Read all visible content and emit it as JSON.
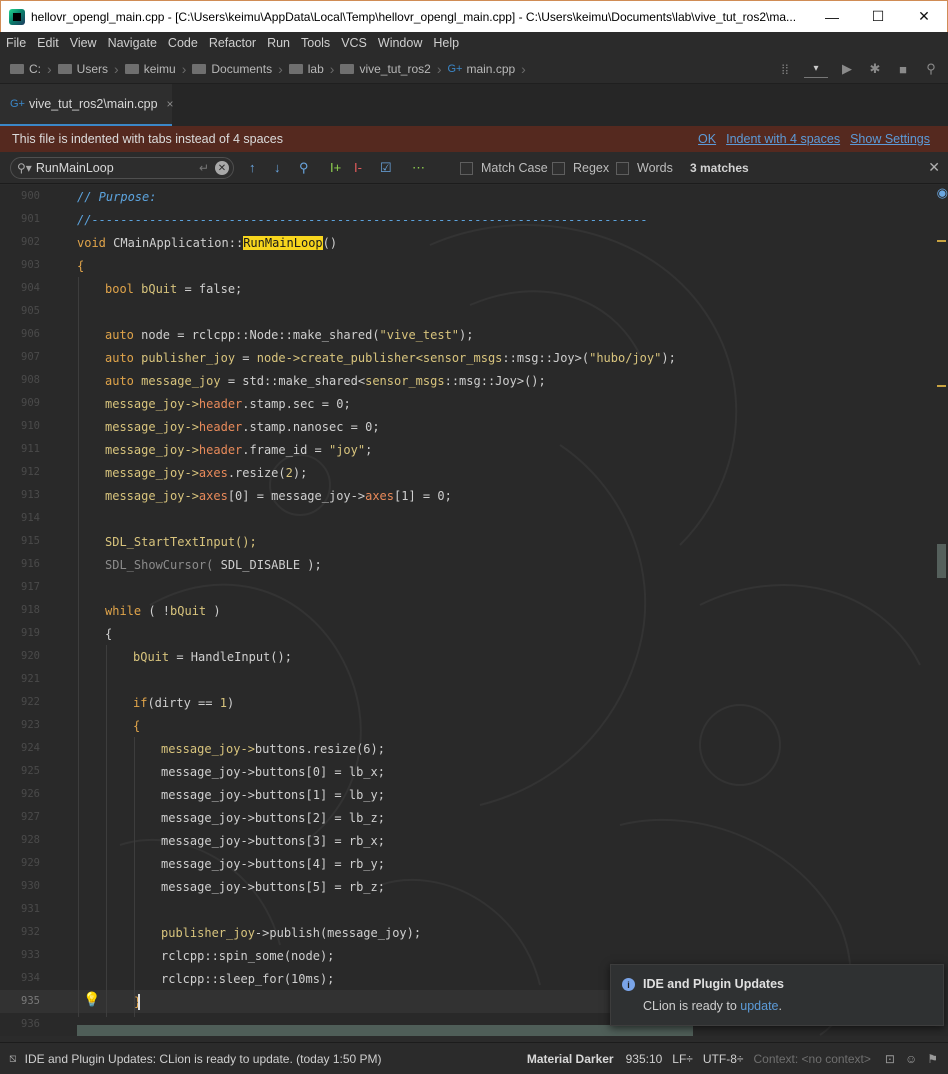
{
  "window": {
    "title": "hellovr_opengl_main.cpp - [C:\\Users\\keimu\\AppData\\Local\\Temp\\hellovr_opengl_main.cpp] - C:\\Users\\keimu\\Documents\\lab\\vive_tut_ros2\\ma...",
    "minimize": "—",
    "maximize": "☐",
    "close": "✕"
  },
  "menu": [
    "File",
    "Edit",
    "View",
    "Navigate",
    "Code",
    "Refactor",
    "Run",
    "Tools",
    "VCS",
    "Window",
    "Help"
  ],
  "breadcrumbs": [
    "C:",
    "Users",
    "keimu",
    "Documents",
    "lab",
    "vive_tut_ros2",
    "main.cpp"
  ],
  "tab": {
    "label": "vive_tut_ros2\\main.cpp",
    "close": "×",
    "icon": "cpp-file-icon"
  },
  "banner": {
    "message": "This file is indented with tabs instead of 4 spaces",
    "ok": "OK",
    "indent": "Indent with 4 spaces",
    "settings": "Show Settings"
  },
  "search": {
    "value": "RunMainLoop",
    "match_case": "Match Case",
    "regex": "Regex",
    "words": "Words",
    "matches": "3 matches"
  },
  "line_numbers": [
    "900",
    "901",
    "902",
    "903",
    "904",
    "905",
    "906",
    "907",
    "908",
    "909",
    "910",
    "911",
    "912",
    "913",
    "914",
    "915",
    "916",
    "917",
    "918",
    "919",
    "920",
    "921",
    "922",
    "923",
    "924",
    "925",
    "926",
    "927",
    "928",
    "929",
    "930",
    "931",
    "932",
    "933",
    "934",
    "935",
    "936"
  ],
  "code_text": {
    "l900": "// Purpose:",
    "l901": "//-----------------------------------------------------------------------------",
    "l902_a": "void",
    "l902_b": " CMainApplication::",
    "l902_c": "RunMainLoop",
    "l902_d": "()",
    "l903": "{",
    "l904_a": "bool",
    "l904_b": " bQuit ",
    "l904_c": "= false;",
    "l906_a": "auto",
    "l906_b": " node = rclcpp::Node::make_shared(",
    "l906_c": "\"vive_test\"",
    "l906_d": ");",
    "l907_a": "auto",
    "l907_b": " publisher_joy",
    "l907_c": " = ",
    "l907_d": "node->create_publisher",
    "l907_e": "<sensor_msgs",
    "l907_f": "::msg::Joy>(",
    "l907_g": "\"hubo/joy\"",
    "l907_h": ");",
    "l908_a": "auto",
    "l908_b": " message_joy",
    "l908_c": " = std::make_shared<",
    "l908_d": "sensor_msgs",
    "l908_e": "::msg::Joy>();",
    "l909_a": "message_joy->",
    "l909_b": "header",
    "l909_c": ".stamp.sec = ",
    "l909_d": "0",
    "l909_e": ";",
    "l910_a": "message_joy->",
    "l910_b": "header",
    "l910_c": ".stamp.nanosec = ",
    "l910_d": "0",
    "l910_e": ";",
    "l911_a": "message_joy->",
    "l911_b": "header",
    "l911_c": ".frame_id = ",
    "l911_d": "\"joy\"",
    "l911_e": ";",
    "l912_a": "message_joy->",
    "l912_b": "axes",
    "l912_c": ".resize(",
    "l912_d": "2",
    "l912_e": ");",
    "l913_a": "message_joy->",
    "l913_b": "axes",
    "l913_c": "[0] = message_joy->",
    "l913_d": "axes",
    "l913_e": "[1] = 0;",
    "l915": "SDL_StartTextInput();",
    "l916_a": "SDL_ShowCursor( ",
    "l916_b": "SDL_DISABLE",
    "l916_c": " );",
    "l918_a": "while",
    "l918_b": " ( !",
    "l918_c": "bQuit",
    "l918_d": " )",
    "l919": "{",
    "l920_a": "bQuit",
    "l920_b": " = HandleInput();",
    "l922_a": "if",
    "l922_b": "(dirty == ",
    "l922_c": "1",
    "l922_d": ")",
    "l923": "{",
    "l924_a": "message_joy->",
    "l924_b": "buttons.resize(",
    "l924_c": "6",
    "l924_d": ");",
    "l925": "message_joy->buttons[0] = lb_x;",
    "l926": "message_joy->buttons[1] = lb_y;",
    "l927": "message_joy->buttons[2] = lb_z;",
    "l928": "message_joy->buttons[3] = rb_x;",
    "l929": "message_joy->buttons[4] = rb_y;",
    "l930": "message_joy->buttons[5] = rb_z;",
    "l932_a": "publisher_joy",
    "l932_b": "->publish(message_joy);",
    "l933": "rclcpp::spin_some(node);",
    "l934_a": "rclcpp::sleep_for(",
    "l934_b": "10ms",
    "l934_c": ");",
    "l935": "}"
  },
  "notification": {
    "title": "IDE and Plugin Updates",
    "body_prefix": "CLion is ready to ",
    "body_link": "update",
    "body_suffix": "."
  },
  "status": {
    "message": "IDE and Plugin Updates: CLion is ready to update. (today 1:50 PM)",
    "theme": "Material Darker",
    "position": "935:10",
    "line_sep": "LF÷",
    "encoding": "UTF-8÷",
    "context": "Context: <no context>"
  },
  "colors": {
    "banner": "#55291f",
    "highlight": "#f7d51d",
    "keyword": "#e0a44a",
    "comment": "#5ca3dd",
    "link": "#5c9bd8"
  }
}
